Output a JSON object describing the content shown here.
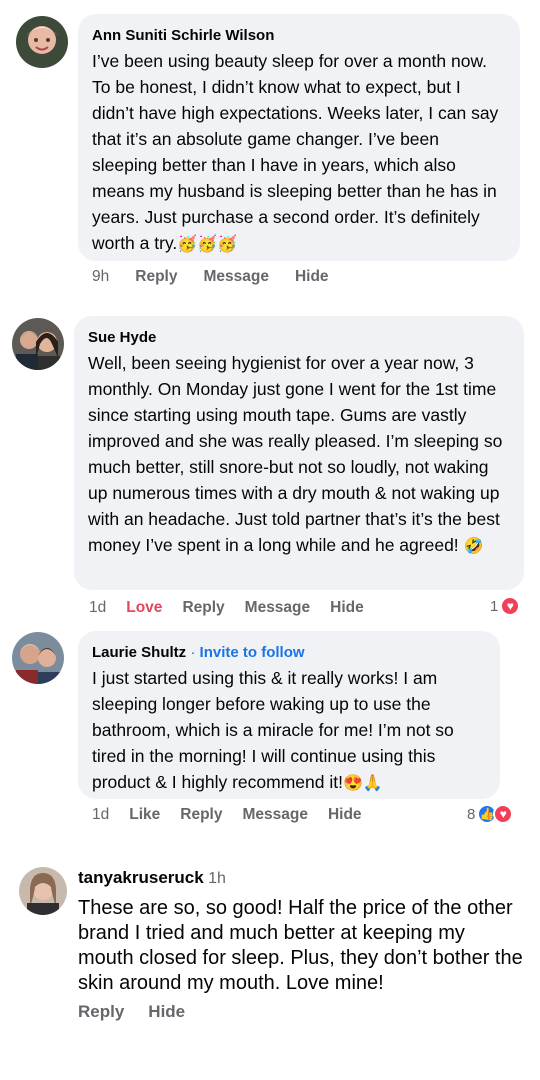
{
  "comments": [
    {
      "name": "Ann Suniti Schirle Wilson",
      "text": "I’ve been using beauty sleep for over a month now. To be honest, I didn’t know what to expect, but I didn’t have high expectations. Weeks later, I can say that it’s an absolute game changer. I’ve been sleeping better than I have in years, which also means my husband is sleeping better than he has in years. Just purchase a second order. It’s definitely worth a try.",
      "emoji": "🥳🥳🥳",
      "time": "9h",
      "actions": [
        "Reply",
        "Message",
        "Hide"
      ]
    },
    {
      "name": "Sue Hyde",
      "text": "Well, been seeing hygienist for over a year now, 3 monthly. On Monday just gone I went for the 1st time since starting using mouth tape.  Gums are vastly improved and she was really pleased. I’m sleeping so much better, still snore-but not so loudly, not waking up numerous times with a dry mouth & not waking up with an headache. Just told partner that’s it’s the best money I’ve spent in a long while and he agreed!",
      "emoji": "🤣",
      "time": "1d",
      "reaction_label": "Love",
      "actions": [
        "Reply",
        "Message",
        "Hide"
      ],
      "reaction_count": "1"
    },
    {
      "name": "Laurie Shultz",
      "separator": "·",
      "follow": "Invite to follow",
      "text": "I just started using this & it really works! I am sleeping longer before waking up to use the bathroom, which is a miracle for me! I’m not so tired in the morning! I will continue using this product & I highly recommend it!",
      "emoji": "😍🙏",
      "time": "1d",
      "actions": [
        "Like",
        "Reply",
        "Message",
        "Hide"
      ],
      "reaction_count": "8"
    },
    {
      "name": "tanyakruseruck",
      "time": "1h",
      "text": "These are so, so good! Half the price of the other brand I tried and much better at keeping my mouth closed for sleep. Plus, they don’t bother the skin around my mouth. Love mine!",
      "actions": [
        "Reply",
        "Hide"
      ]
    }
  ],
  "colors": {
    "bubble": "#f0f2f5",
    "meta": "#65676b",
    "link": "#1b74e4",
    "love": "#e4465e"
  },
  "icons": [
    "heart-reaction-icon",
    "like-reaction-icon"
  ]
}
